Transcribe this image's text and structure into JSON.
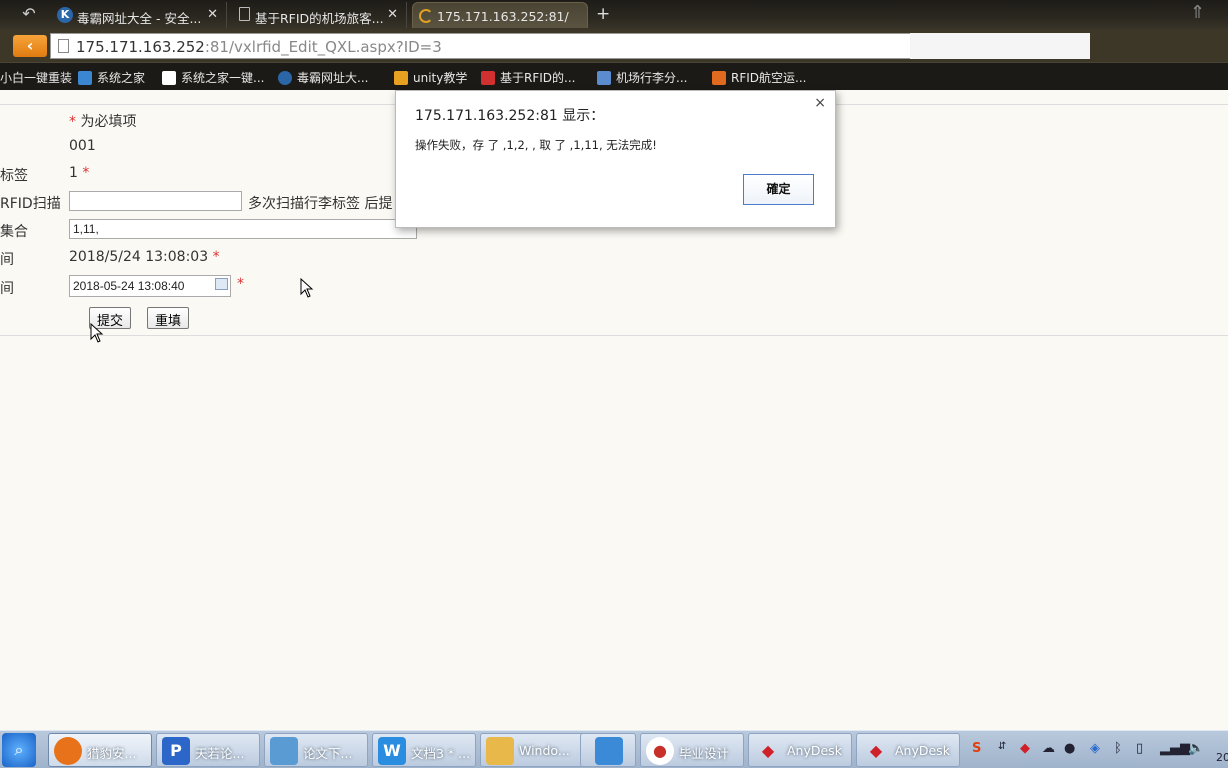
{
  "browser": {
    "tabs": [
      {
        "label": "毒霸网址大全 - 安全...",
        "icon": "k-icon",
        "active": false
      },
      {
        "label": "基于RFID的机场旅客...",
        "icon": "document-icon",
        "active": false
      },
      {
        "label": "175.171.163.252:81/",
        "icon": "loading-icon",
        "active": true
      }
    ],
    "new_tab": "+",
    "url_host": "175.171.163.252",
    "url_rest": ":81/vxlrfid_Edit_QXL.aspx?ID=3",
    "bookmarks": [
      {
        "label": "小白一键重装",
        "icon": "none"
      },
      {
        "label": "系统之家",
        "icon": "system-home-icon"
      },
      {
        "label": "系统之家一键...",
        "icon": "document-icon"
      },
      {
        "label": "毒霸网址大...",
        "icon": "k-icon"
      },
      {
        "label": "unity教学",
        "icon": "folder-icon"
      },
      {
        "label": "基于RFID的...",
        "icon": "red-doc-icon"
      },
      {
        "label": "机场行李分...",
        "icon": "network-icon"
      },
      {
        "label": "RFID航空运...",
        "icon": "orange-icon"
      }
    ]
  },
  "form": {
    "required_note": "为必填项",
    "asterisk": "*",
    "id_value": "001",
    "tag_label": "标签",
    "tag_value": "1",
    "rfid_label": "RFID扫描",
    "rfid_input": "",
    "rfid_hint": "多次扫描行李标签 后提",
    "set_label": "集合",
    "set_value": "1,11,",
    "time1_label": "间",
    "time1_value": "2018/5/24 13:08:03",
    "time2_label": "间",
    "time2_value": "2018-05-24 13:08:40",
    "submit_label": "提交",
    "reset_label": "重填"
  },
  "dialog": {
    "title": "175.171.163.252:81 显示：",
    "message": "操作失败，存 了 ,1,2, , 取 了 ,1,11, 无法完成!",
    "ok_label": "確定",
    "close_symbol": "×"
  },
  "taskbar": {
    "items": [
      {
        "label": "猎豹安...",
        "icon": "cheetah-icon",
        "color": "#e8721a"
      },
      {
        "label": "天若论...",
        "icon": "p-icon",
        "color": "#2c66c8"
      },
      {
        "label": "论文下...",
        "icon": "document-icon",
        "color": "#5a9bd4"
      },
      {
        "label": "文档3 * ...",
        "icon": "wps-icon",
        "color": "#2a8de0"
      },
      {
        "label": "Windo...",
        "icon": "explorer-icon",
        "color": "#e8b94a"
      },
      {
        "label": "",
        "icon": "bird-icon",
        "color": "#3a8ad8"
      },
      {
        "label": "毕业设计",
        "icon": "graduation-icon",
        "color": "#c8302a"
      },
      {
        "label": "AnyDesk",
        "icon": "anydesk-icon",
        "color": "#d0202a"
      },
      {
        "label": "AnyDesk",
        "icon": "anydesk-icon",
        "color": "#d0202a"
      }
    ],
    "clock_partial": "20"
  }
}
